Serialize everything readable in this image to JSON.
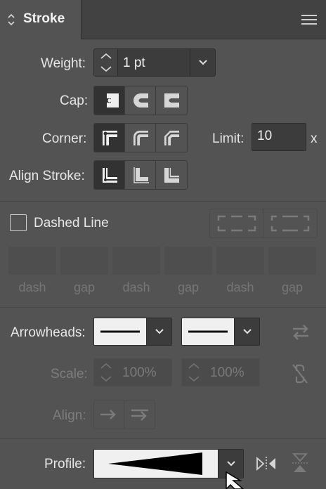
{
  "panel": {
    "title": "Stroke",
    "tab_icon": "collapse-arrows-icon",
    "menu_icon": "panel-menu-icon"
  },
  "weight": {
    "label": "Weight:",
    "value": "1 pt"
  },
  "cap": {
    "label": "Cap:",
    "options": [
      "butt-cap-icon",
      "round-cap-icon",
      "projecting-cap-icon"
    ],
    "selected": 0
  },
  "corner": {
    "label": "Corner:",
    "options": [
      "miter-join-icon",
      "round-join-icon",
      "bevel-join-icon"
    ],
    "selected": 0
  },
  "limit": {
    "label": "Limit:",
    "value": "10",
    "unit": "x"
  },
  "align_stroke": {
    "label": "Align Stroke:",
    "options": [
      "align-center-icon",
      "align-inside-icon",
      "align-outside-icon"
    ],
    "selected": 0
  },
  "dashed_line": {
    "label": "Dashed Line",
    "checked": false
  },
  "dash_fields": [
    "dash",
    "gap",
    "dash",
    "gap",
    "dash",
    "gap"
  ],
  "arrowheads": {
    "label": "Arrowheads:",
    "swap_icon": "swap-arrowheads-icon"
  },
  "scale": {
    "label": "Scale:",
    "start": "100%",
    "end": "100%",
    "link_icon": "unlink-icon"
  },
  "align": {
    "label": "Align:"
  },
  "profile": {
    "label": "Profile:",
    "flip_horizontal_icon": "flip-horizontal-icon",
    "flip_vertical_icon": "flip-vertical-icon"
  },
  "colors": {
    "panel_bg": "#535353",
    "titlebar_bg": "#424242",
    "field_bg": "#3c3c3c",
    "text": "#e6e6e6",
    "disabled_text": "#7d7d7d"
  }
}
